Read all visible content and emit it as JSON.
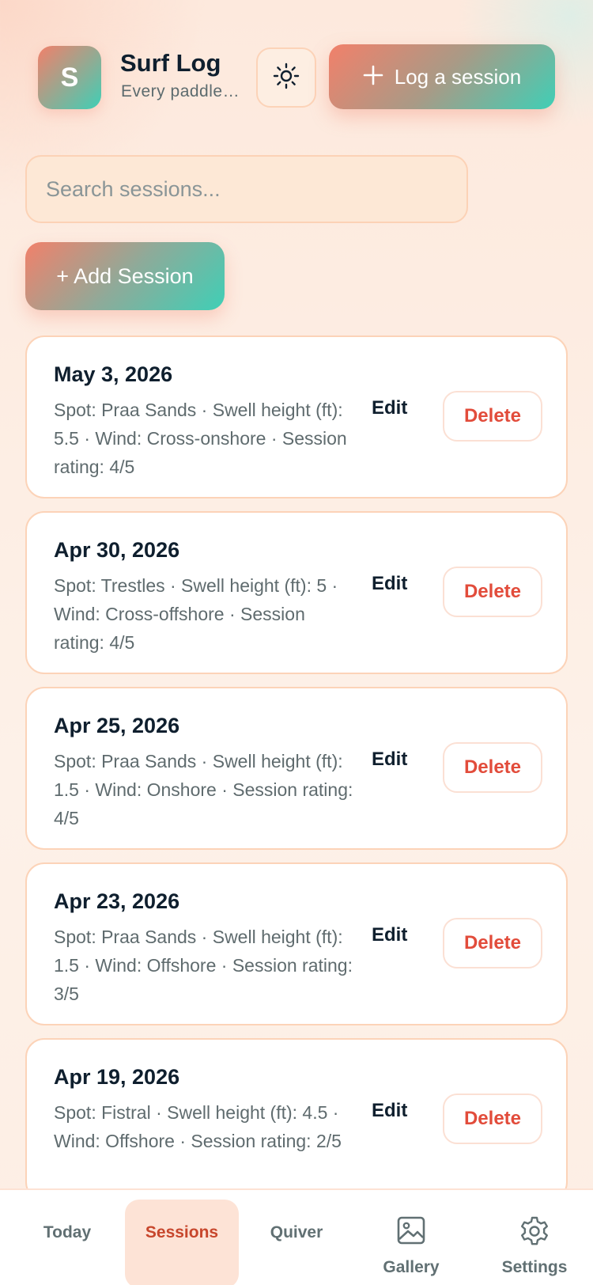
{
  "header": {
    "logo_letter": "S",
    "title": "Surf Log",
    "subtitle": "Every paddle out, logged",
    "log_button": "Log a session"
  },
  "search": {
    "placeholder": "Search sessions...",
    "value": ""
  },
  "add_button": "+ Add Session",
  "sessions": [
    {
      "date": "May 3, 2026",
      "description": "Spot: Praa Sands · Swell height (ft): 5.5 · Wind: Cross-onshore · Session rating: 4/5",
      "edit": "Edit",
      "delete": "Delete"
    },
    {
      "date": "Apr 30, 2026",
      "description": "Spot: Trestles · Swell height (ft): 5 · Wind: Cross-offshore · Session rating: 4/5",
      "edit": "Edit",
      "delete": "Delete"
    },
    {
      "date": "Apr 25, 2026",
      "description": "Spot: Praa Sands · Swell height (ft): 1.5 · Wind: Onshore · Session rating: 4/5",
      "edit": "Edit",
      "delete": "Delete"
    },
    {
      "date": "Apr 23, 2026",
      "description": "Spot: Praa Sands · Swell height (ft): 1.5 · Wind: Offshore · Session rating: 3/5",
      "edit": "Edit",
      "delete": "Delete"
    },
    {
      "date": "Apr 19, 2026",
      "description": "Spot: Fistral · Swell height (ft): 4.5 · Wind: Offshore · Session rating: 2/5",
      "edit": "Edit",
      "delete": "Delete"
    }
  ],
  "nav": {
    "today": "Today",
    "sessions": "Sessions",
    "quiver": "Quiver",
    "gallery": "Gallery",
    "settings": "Settings",
    "active": "sessions"
  },
  "icons": {
    "theme": "sun-icon",
    "log": "plus-icon",
    "gallery": "image-icon",
    "settings": "gear-icon"
  },
  "colors": {
    "accent_start": "#f2806a",
    "accent_end": "#3fcfb6",
    "delete": "#e24c3b",
    "active_nav": "#c7462c"
  }
}
